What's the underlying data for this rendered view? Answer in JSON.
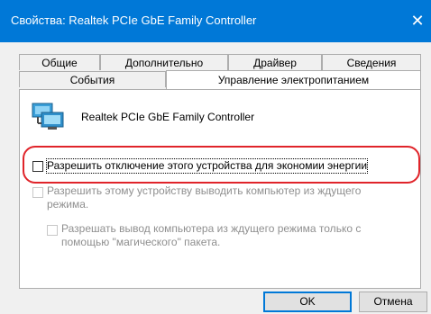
{
  "window": {
    "title": "Свойства: Realtek PCIe GbE Family Controller",
    "close_glyph": "✕"
  },
  "tabs": {
    "row1": [
      "Общие",
      "Дополнительно",
      "Драйвер",
      "Сведения"
    ],
    "row2": [
      "События",
      "Управление электропитанием"
    ],
    "active": "Управление электропитанием"
  },
  "device": {
    "icon": "network-adapter-icon",
    "name": "Realtek PCIe GbE Family Controller"
  },
  "options": {
    "allow_power_off": {
      "label": "Разрешить отключение этого устройства для экономии энергии",
      "checked": false,
      "enabled": true
    },
    "allow_wake": {
      "label_line1": "Разрешить этому устройству выводить компьютер из ждущего",
      "label_line2": "режима.",
      "checked": false,
      "enabled": false
    },
    "magic_packet_only": {
      "label_line1": "Разрешать вывод компьютера из ждущего режима только с",
      "label_line2": "помощью \"магического\" пакета.",
      "checked": false,
      "enabled": false
    }
  },
  "buttons": {
    "ok": "OK",
    "cancel": "Отмена"
  },
  "colors": {
    "titlebar": "#0078d7",
    "highlight": "#e0242a",
    "disabled_text": "#8f8f8f"
  }
}
